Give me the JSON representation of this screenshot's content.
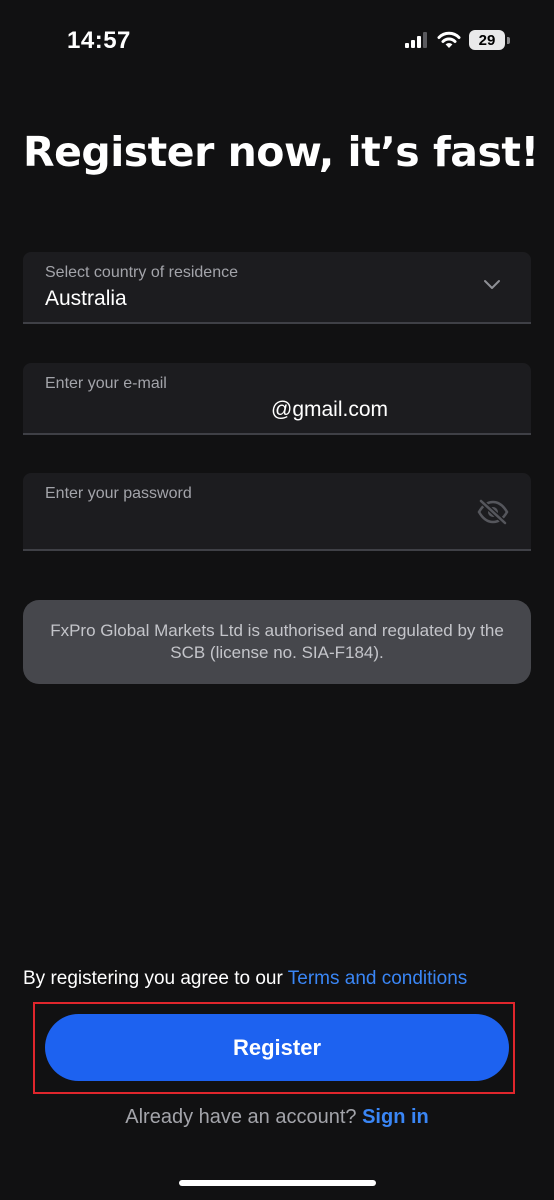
{
  "status_bar": {
    "time": "14:57",
    "battery": "29",
    "icons": [
      "cellular-signal-icon",
      "wifi-icon",
      "battery-icon"
    ]
  },
  "title": "Register now, it’s fast!",
  "form": {
    "country": {
      "label": "Select country of residence",
      "value": "Australia"
    },
    "email": {
      "label": "Enter your e-mail",
      "value": "@gmail.com"
    },
    "password": {
      "label": "Enter your password",
      "value": ""
    }
  },
  "info": "FxPro Global Markets Ltd is authorised and regulated by the SCB (license no. SIA-F184).",
  "agreement": {
    "text": "By registering you agree to our ",
    "link": "Terms and conditions"
  },
  "register_label": "Register",
  "signin": {
    "text": "Already have an account? ",
    "link": "Sign in"
  },
  "colors": {
    "background": "#111112",
    "accent": "#1d62f0",
    "link": "#3a86f5",
    "highlight": "#e0262c"
  }
}
